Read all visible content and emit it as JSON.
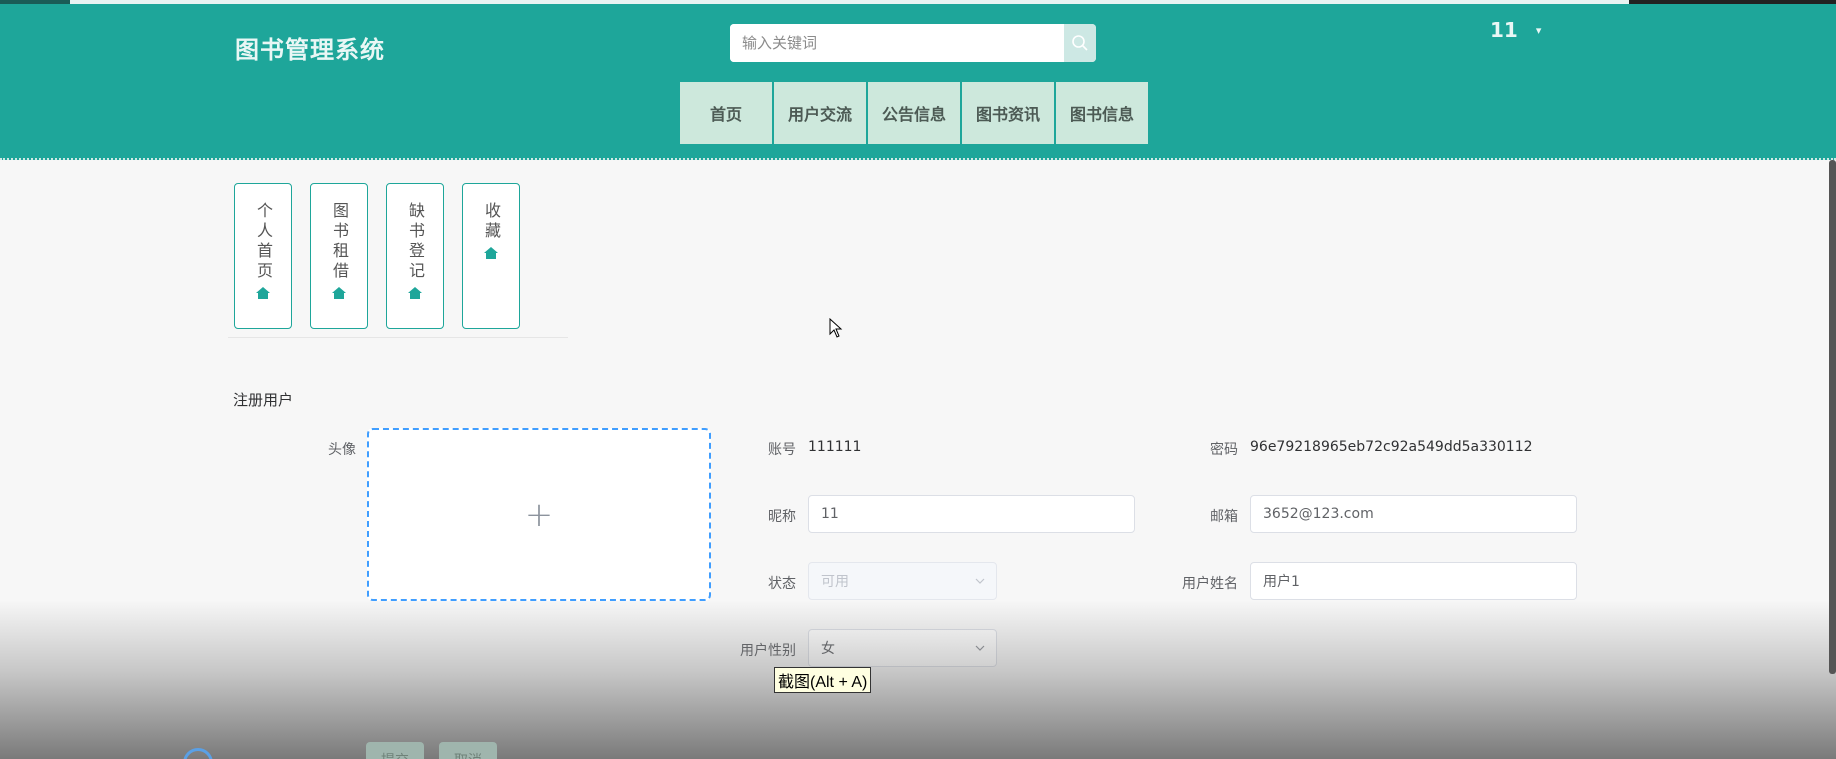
{
  "header": {
    "logo": "图书管理系统",
    "search_placeholder": "输入关键词",
    "username": "11"
  },
  "nav": {
    "items": [
      {
        "label": "首页"
      },
      {
        "label": "用户交流"
      },
      {
        "label": "公告信息"
      },
      {
        "label": "图书资讯"
      },
      {
        "label": "图书信息"
      }
    ]
  },
  "sidebar": {
    "items": [
      {
        "label": "个人首页"
      },
      {
        "label": "图书租借"
      },
      {
        "label": "缺书登记"
      },
      {
        "label": "收藏"
      }
    ]
  },
  "form": {
    "title": "注册用户",
    "avatar_label": "头像",
    "account_label": "账号",
    "account_value": "111111",
    "password_label": "密码",
    "password_value": "96e79218965eb72c92a549dd5a330112",
    "nickname_label": "昵称",
    "nickname_value": "11",
    "email_label": "邮箱",
    "email_value": "3652@123.com",
    "status_label": "状态",
    "status_value": "可用",
    "realname_label": "用户姓名",
    "realname_value": "用户1",
    "gender_label": "用户性别",
    "gender_value": "女"
  },
  "footer": {
    "submit_label": "提交",
    "cancel_label": "取消"
  },
  "tooltip": {
    "text": "截图(Alt + A)"
  },
  "colors": {
    "header_bg": "#1ea69a",
    "nav_bg": "#cde8dc",
    "uploader_border": "#409eff"
  }
}
